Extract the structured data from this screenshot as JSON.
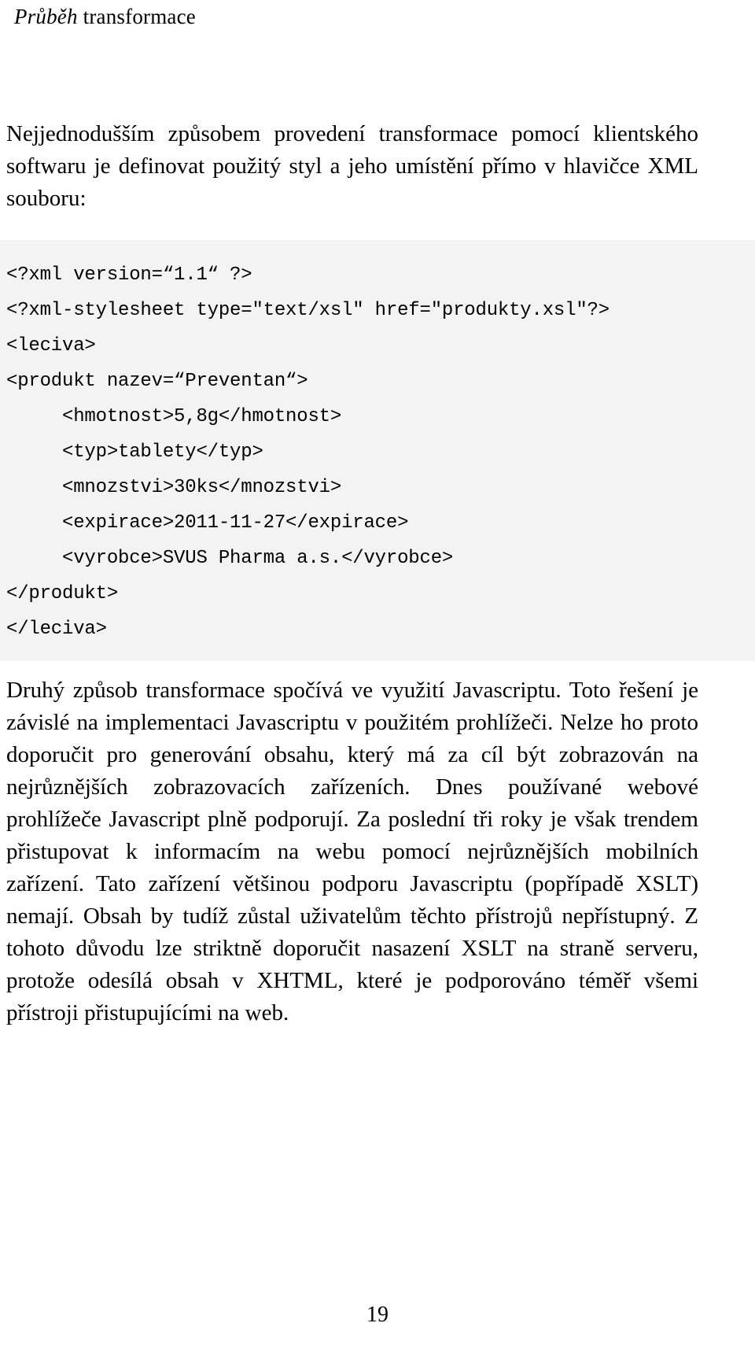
{
  "document": {
    "header": {
      "italic_part": "Průběh",
      "roman_part": " transformace"
    },
    "page_number": "19",
    "accent_background": "#f3f3f3",
    "text_color": "#000000"
  },
  "paragraphs": {
    "intro": "Nejjednodušším způsobem provedení transformace pomocí klientského softwaru je definovat použitý styl a jeho umístění přímo v hlavičce XML souboru:",
    "after_code": "Druhý způsob transformace spočívá ve využití Javascriptu. Toto řešení je závislé na implementaci Javascriptu v použitém prohlížeči. Nelze ho proto doporučit pro generování obsahu, který má za cíl být zobrazován na nejrůznějších zobrazovacích zařízeních. Dnes používané webové prohlížeče Javascript plně podporují. Za poslední tři roky je však trendem přistupovat k informacím na webu pomocí nejrůznějších mobilních zařízení. Tato zařízení většinou podporu  Javascriptu (popřípadě XSLT) nemají. Obsah by tudíž zůstal uživatelům těchto přístrojů nepřístupný. Z tohoto důvodu lze striktně doporučit nasazení XSLT na straně serveru, protože odesílá obsah v XHTML, které je podporováno téměř všemi přístroji přistupujícími na web."
  },
  "code_listing": {
    "language": "xml",
    "lines": [
      "<?xml version=“1.1“ ?>",
      "<?xml-stylesheet type=\"text/xsl\" href=\"produkty.xsl\"?>",
      "<leciva>",
      "<produkt nazev=“Preventan“>",
      "     <hmotnost>5,8g</hmotnost>",
      "     <typ>tablety</typ>",
      "     <mnozstvi>30ks</mnozstvi>",
      "     <expirace>2011-11-27</expirace>",
      "     <vyrobce>SVUS Pharma a.s.</vyrobce>",
      "</produkt>",
      "</leciva>"
    ]
  }
}
